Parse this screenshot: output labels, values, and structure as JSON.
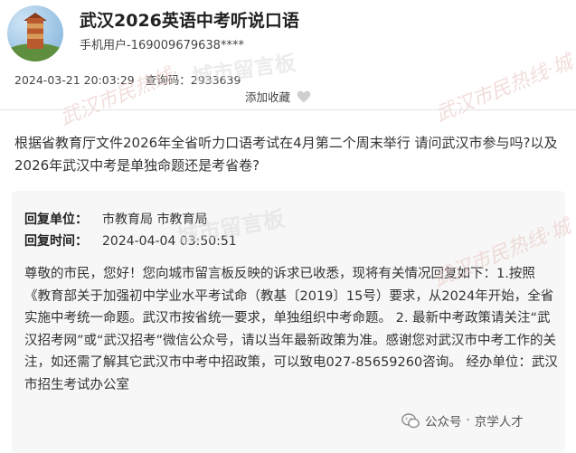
{
  "header": {
    "title": "武汉2026英语中考听说口语",
    "user": "手机用户-169009679638****",
    "date": "2024-03-21 20:03:29",
    "query_label": "查询码：",
    "query_code": "2933639",
    "favorite_label": "添加收藏"
  },
  "question": "根据省教育厅文件2026年全省听力口语考试在4月第二个周末举行 请问武汉市参与吗?以及2026年武汉中考是单独命题还是考省卷?",
  "reply": {
    "unit_label": "回复单位：",
    "unit_value": "市教育局 市教育局",
    "time_label": "回复时间：",
    "time_value": "2024-04-04 03:50:51",
    "body": "尊敬的市民，您好！您向城市留言板反映的诉求已收悉，现将有关情况回复如下：1.按照《教育部关于加强初中学业水平考试命（教基〔2019〕15号）要求，从2024年开始，全省实施中考统一命题。武汉市按省统一要求，单独组织中考命题。 2. 最新中考政策请关注“武汉招考网”或“武汉招考”微信公众号，请以当年最新政策为准。感谢您对武汉市中考工作的关注，如还需了解其它武汉市中考中招政策，可以致电027-85659260咨询。 经办单位：武汉市招生考试办公室"
  },
  "watermarks": {
    "board_1": "城市留言板",
    "board_2": "城市留言板",
    "cursive_1": "武汉市民热线·",
    "cursive_2": "武汉市民热线·城",
    "cursive_3": "武汉市民热线·城"
  },
  "wechat": {
    "label": "公众号",
    "separator": "·",
    "account": "京学人才"
  }
}
